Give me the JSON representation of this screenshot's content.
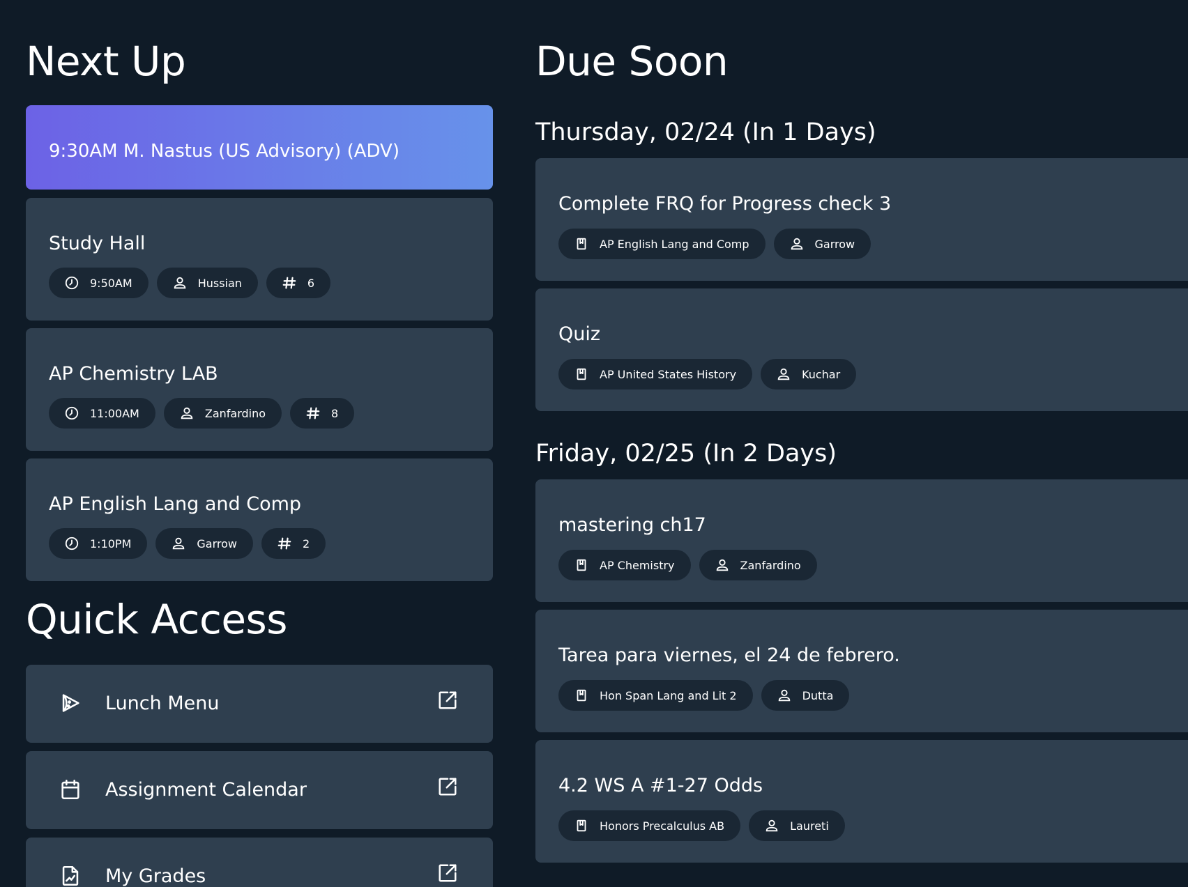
{
  "next_up": {
    "title": "Next Up",
    "current": "9:30AM M. Nastus (US Advisory) (ADV)",
    "classes": [
      {
        "name": "Study Hall",
        "time": "9:50AM",
        "teacher": "Hussian",
        "room": "6"
      },
      {
        "name": "AP Chemistry LAB",
        "time": "11:00AM",
        "teacher": "Zanfardino",
        "room": "8"
      },
      {
        "name": "AP English Lang and Comp",
        "time": "1:10PM",
        "teacher": "Garrow",
        "room": "2"
      }
    ]
  },
  "quick_access": {
    "title": "Quick Access",
    "items": [
      {
        "label": "Lunch Menu",
        "icon": "pizza-icon"
      },
      {
        "label": "Assignment Calendar",
        "icon": "calendar-icon"
      },
      {
        "label": "My Grades",
        "icon": "grades-icon"
      }
    ]
  },
  "due_soon": {
    "title": "Due Soon",
    "days": [
      {
        "heading": "Thursday, 02/24 (In 1 Days)",
        "assignments": [
          {
            "title": "Complete FRQ for Progress check 3",
            "course": "AP English Lang and Comp",
            "teacher": "Garrow"
          },
          {
            "title": "Quiz",
            "course": "AP United States History",
            "teacher": "Kuchar"
          }
        ]
      },
      {
        "heading": "Friday, 02/25 (In 2 Days)",
        "assignments": [
          {
            "title": "mastering ch17",
            "course": "AP Chemistry",
            "teacher": "Zanfardino"
          },
          {
            "title": "Tarea para viernes, el 24 de febrero.",
            "course": "Hon Span Lang and Lit 2",
            "teacher": "Dutta"
          },
          {
            "title": "4.2 WS A #1-27 Odds",
            "course": "Honors Precalculus AB",
            "teacher": "Laureti"
          }
        ]
      }
    ]
  }
}
